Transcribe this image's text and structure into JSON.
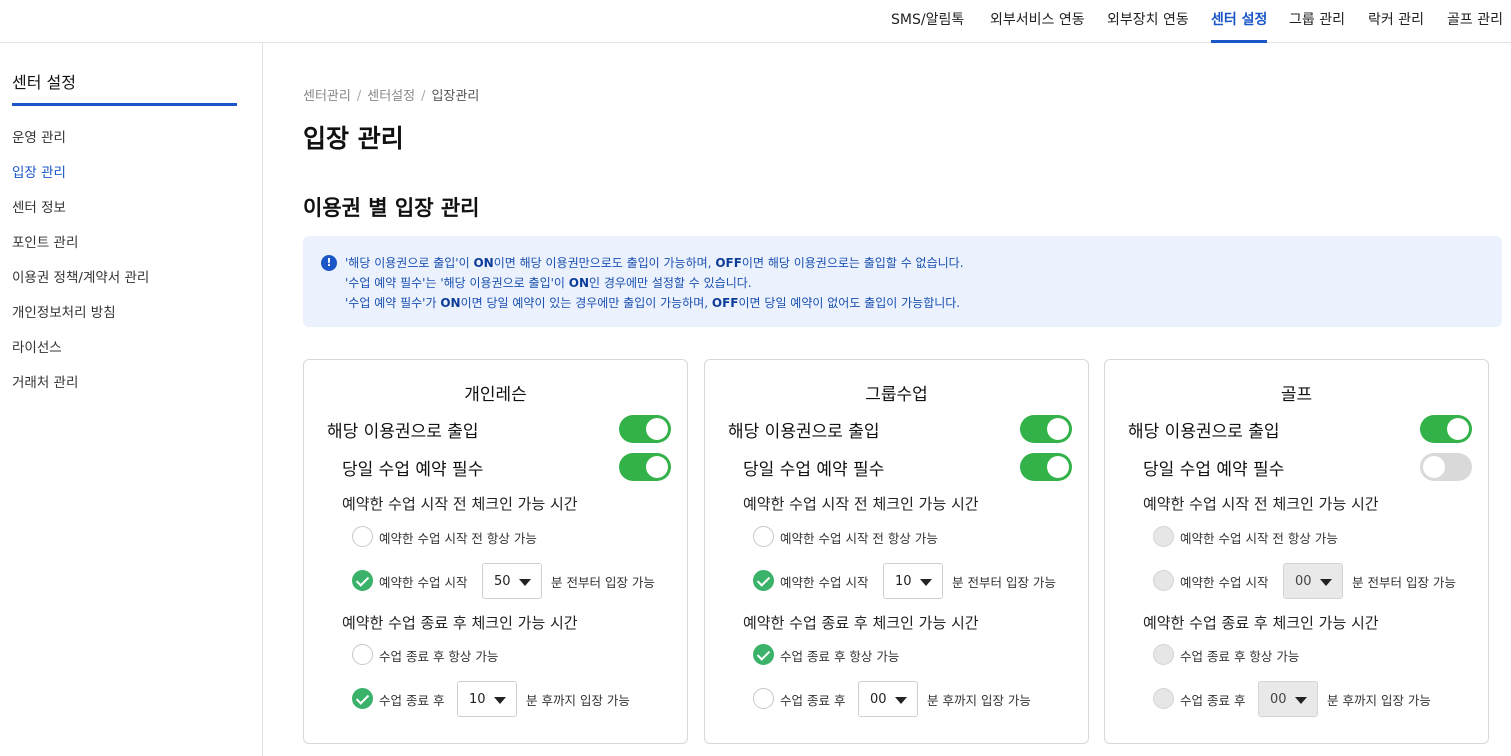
{
  "topnav": {
    "tabs": [
      "SMS/알림톡",
      "외부서비스 연동",
      "외부장치 연동",
      "센터 설정",
      "그룹 관리",
      "락커 관리",
      "골프 관리"
    ]
  },
  "sidebar": {
    "title": "센터 설정",
    "items": [
      "운영 관리",
      "입장 관리",
      "센터 정보",
      "포인트 관리",
      "이용권 정책/계약서 관리",
      "개인정보처리 방침",
      "라이선스",
      "거래처 관리"
    ]
  },
  "breadcrumb": [
    "센터관리",
    "센터설정",
    "입장관리"
  ],
  "page_title": "입장 관리",
  "section_title": "이용권 별 입장 관리",
  "info": {
    "icon": "info-icon",
    "line1": {
      "a": "'해당 이용권으로 출입'이 ",
      "b": "ON",
      "c": "이면 해당 이용권만으로도 출입이 가능하며, ",
      "d": "OFF",
      "e": "이면 해당 이용권으로는 출입할 수 없습니다."
    },
    "line2": {
      "a": "'수업 예약 필수'는 '해당 이용권으로 출입'이 ",
      "b": "ON",
      "c": "인 경우에만 설정할 수 있습니다."
    },
    "line3": {
      "a": "'수업 예약 필수'가 ",
      "b": "ON",
      "c": "이면 당일 예약이 있는 경우에만 출입이 가능하며, ",
      "d": "OFF",
      "e": "이면 당일 예약이 없어도 출입이 가능합니다."
    }
  },
  "labels": {
    "entry_toggle": "해당 이용권으로 출입",
    "reservation_required": "당일 수업 예약 필수",
    "before_title": "예약한 수업 시작 전 체크인 가능 시간",
    "before_always": "예약한 수업 시작 전 항상 가능",
    "before_prefix": "예약한 수업 시작",
    "before_suffix": "분 전부터 입장 가능",
    "after_title": "예약한 수업 종료 후 체크인 가능 시간",
    "after_always": "수업 종료 후 항상 가능",
    "after_prefix": "수업 종료 후",
    "after_suffix": "분 후까지 입장 가능"
  },
  "cards": [
    {
      "title": "개인레슨",
      "entry_on": true,
      "reservation_on": true,
      "before_choice": "minutes",
      "before_minutes": "50",
      "after_choice": "minutes",
      "after_minutes": "10",
      "disabled": false
    },
    {
      "title": "그룹수업",
      "entry_on": true,
      "reservation_on": true,
      "before_choice": "minutes",
      "before_minutes": "10",
      "after_choice": "always",
      "after_minutes": "00",
      "disabled": false
    },
    {
      "title": "골프",
      "entry_on": true,
      "reservation_on": false,
      "before_choice": "none",
      "before_minutes": "00",
      "after_choice": "none",
      "after_minutes": "00",
      "disabled": true
    }
  ],
  "colors": {
    "accent": "#1a56c8",
    "toggle_on": "#34b24a",
    "check": "#3ab26a",
    "info_bg": "#ebf2fd"
  }
}
